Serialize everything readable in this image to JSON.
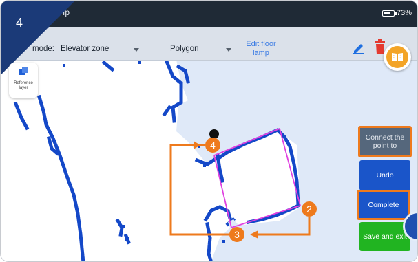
{
  "step_badge": "4",
  "status_bar": {
    "title": "ıp",
    "battery": "73%"
  },
  "toolbar": {
    "mode_label": "mode:",
    "mode_value": "Elevator zone",
    "shape_value": "Polygon",
    "edit_link": "Edit floor lamp"
  },
  "reference_layer": {
    "label_line1": "Reference",
    "label_line2": "layer"
  },
  "side_buttons": {
    "connect": "Connect the point to",
    "undo": "Undo",
    "complete": "Complete",
    "save_exit": "Save and exit"
  },
  "callouts": {
    "c2": "2",
    "c3": "3",
    "c4": "4"
  },
  "colors": {
    "accent_orange": "#ee7a1d",
    "primary_blue": "#1a55c9",
    "save_green": "#21b421",
    "polygon_magenta": "#e040e0",
    "wall_blue": "#1448c8"
  },
  "icons": [
    "pencil-icon",
    "trash-icon",
    "book-icon",
    "layers-icon",
    "battery-icon",
    "dropdown-arrow-icon"
  ]
}
